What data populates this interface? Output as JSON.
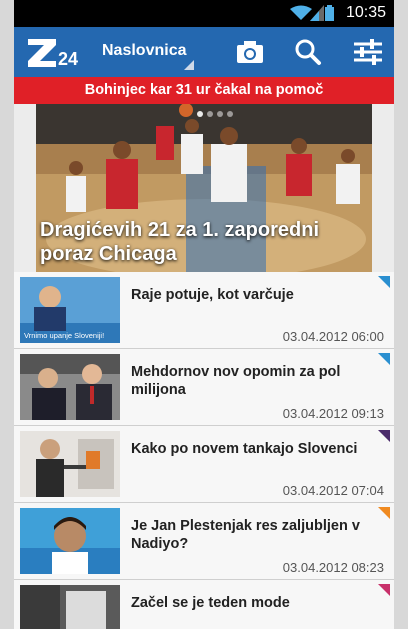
{
  "status_bar": {
    "time": "10:35"
  },
  "app_bar": {
    "logo_text": "Z24",
    "section": "Naslovnica",
    "icons": [
      "camera-icon",
      "search-icon",
      "settings-sliders-icon"
    ],
    "color": "#2468b0"
  },
  "ticker": {
    "text": "Bohinjec kar 31 ur čakal na pomoč",
    "color": "#e02027"
  },
  "hero": {
    "caption": "Dragićevih 21 za 1. zaporedni poraz Chicaga"
  },
  "articles": [
    {
      "title": "Raje potuje, kot varčuje",
      "date": "03.04.2012 06:00",
      "thumb_text": "Vrnimo upanje Sloveniji!",
      "corner_color": "#2a8fd0"
    },
    {
      "title": "Mehdornov nov opomin za pol milijona",
      "date": "03.04.2012 09:13",
      "corner_color": "#2a8fd0"
    },
    {
      "title": "Kako po novem tankajo Slovenci",
      "date": "03.04.2012 07:04",
      "corner_color": "#4a2a6a"
    },
    {
      "title": "Je Jan Plestenjak res zaljubljen v Nadiyo?",
      "date": "03.04.2012 08:23",
      "corner_color": "#f08a20"
    },
    {
      "title": "Začel se je teden mode",
      "date": "",
      "corner_color": "#c8306a"
    }
  ]
}
